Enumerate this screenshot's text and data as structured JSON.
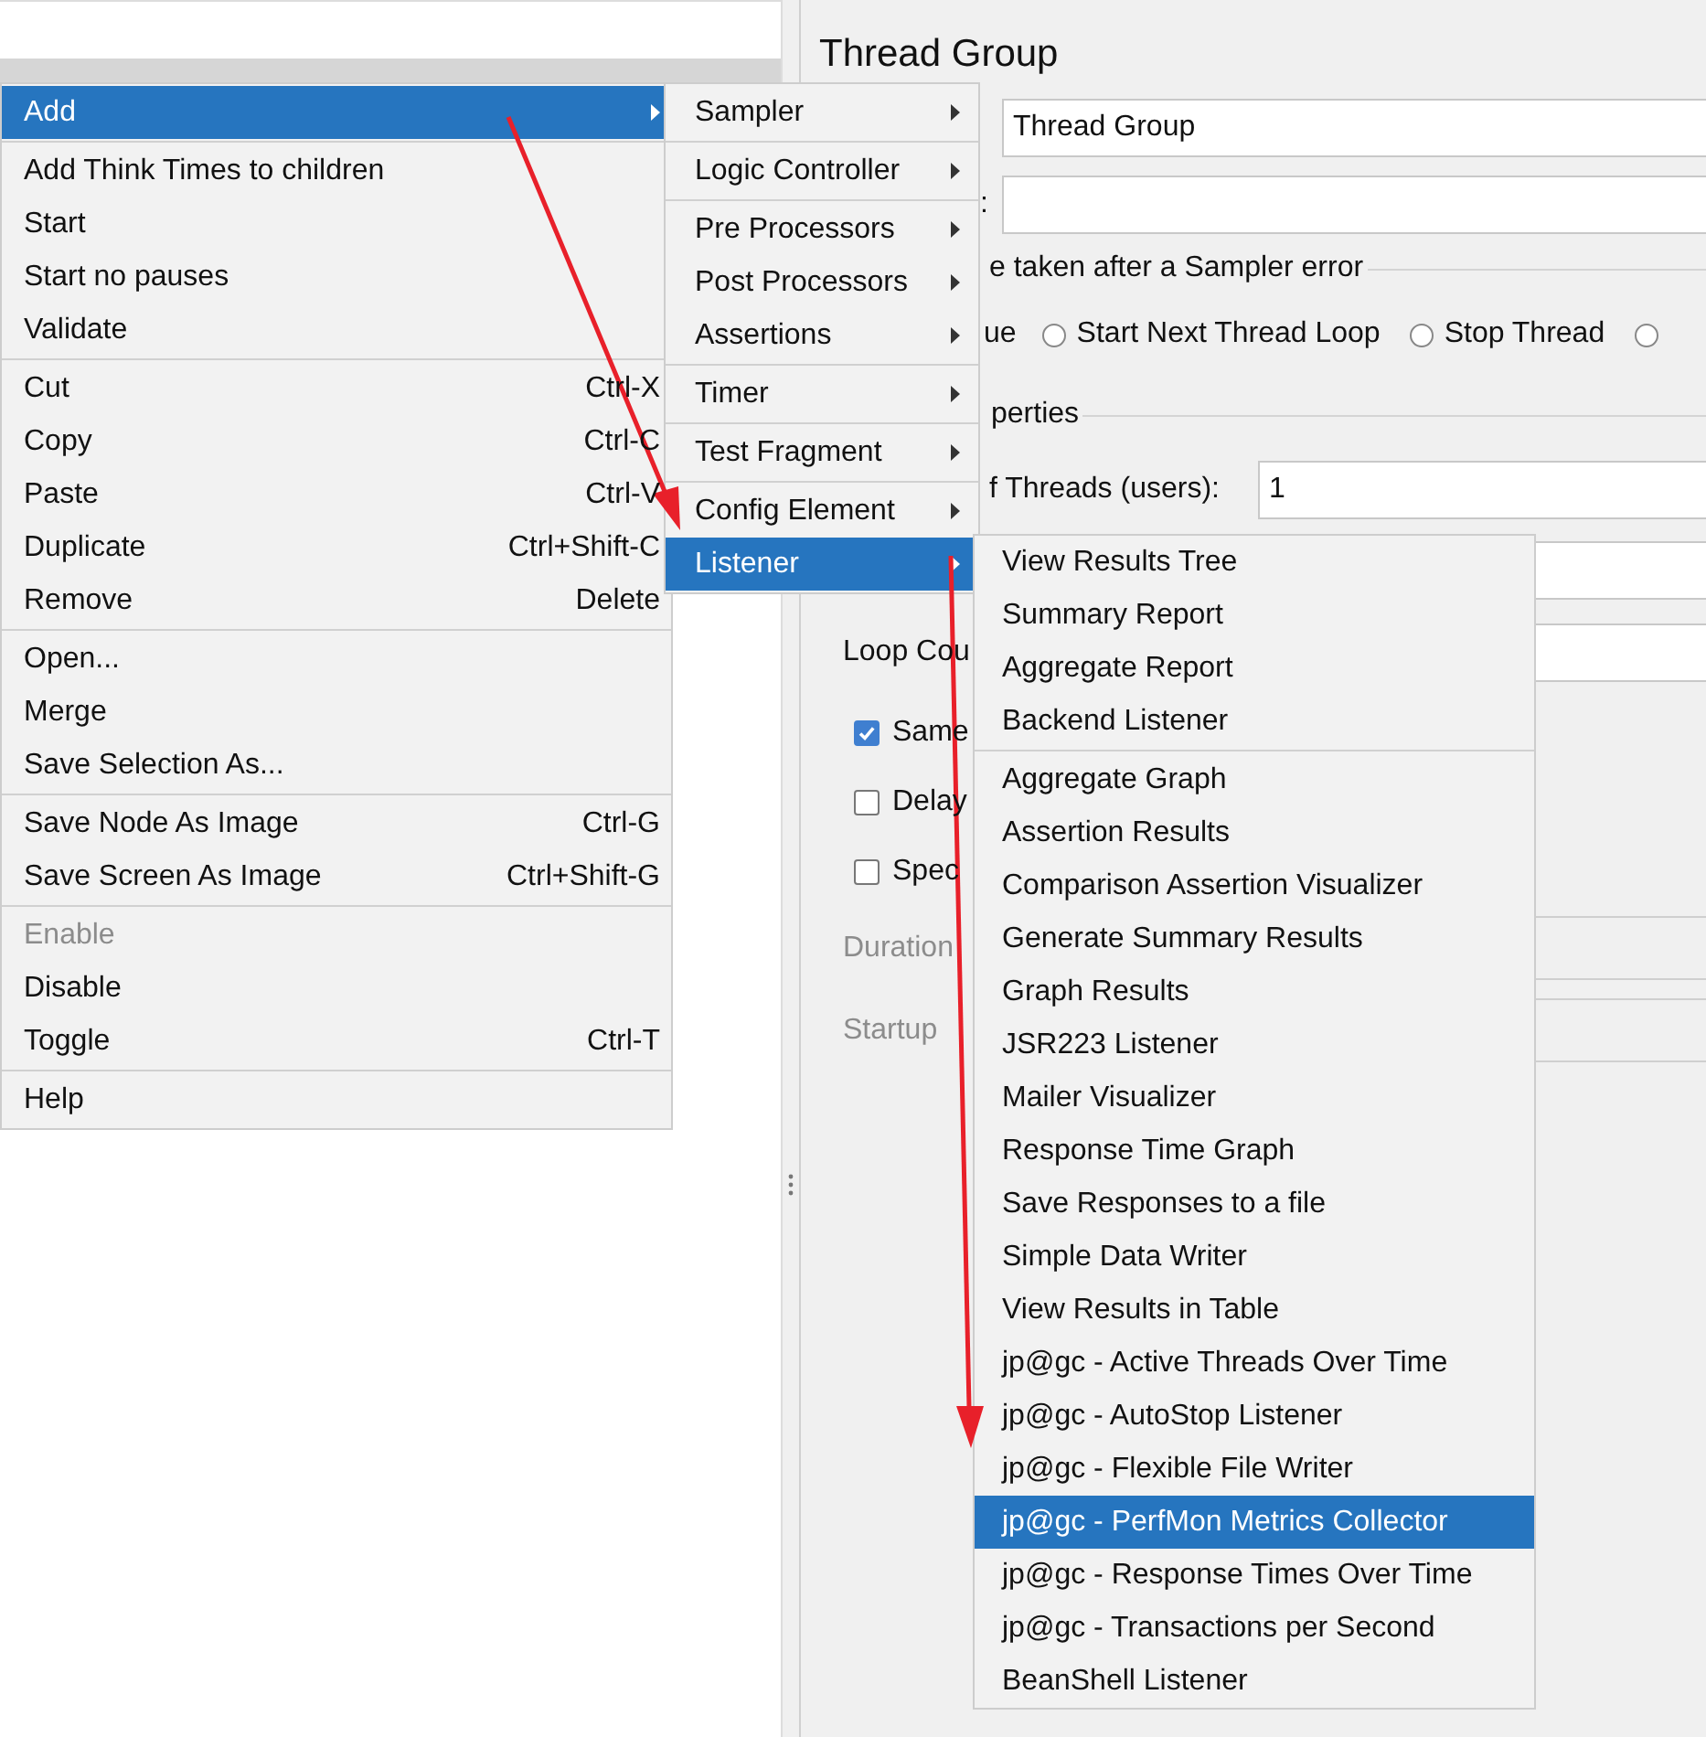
{
  "panel": {
    "title": "Thread Group",
    "name_field": {
      "value": "Thread Group"
    },
    "comments_label": ":",
    "error_group": {
      "title": "e taken after a Sampler error",
      "fragment": "ue",
      "options": [
        {
          "label": "Start Next Thread Loop",
          "selected": false
        },
        {
          "label": "Stop Thread",
          "selected": false
        },
        {
          "selected": false
        }
      ]
    },
    "properties_title": "perties",
    "threads": {
      "label": "f Threads (users):",
      "value": "1"
    },
    "loop_label": "Loop Cou",
    "checkboxes": [
      {
        "label": "Same",
        "checked": true
      },
      {
        "label": "Delay",
        "checked": false
      },
      {
        "label": "Spec",
        "checked": false
      }
    ],
    "disabled_rows": [
      {
        "label": "Duration",
        "disabled": true
      },
      {
        "label": "Startup",
        "disabled": true
      }
    ]
  },
  "context_menu": [
    {
      "kind": "submenu",
      "label": "Add",
      "selected": true
    },
    {
      "kind": "separator"
    },
    {
      "kind": "item",
      "label": "Add Think Times to children"
    },
    {
      "kind": "item",
      "label": "Start"
    },
    {
      "kind": "item",
      "label": "Start no pauses"
    },
    {
      "kind": "item",
      "label": "Validate"
    },
    {
      "kind": "separator"
    },
    {
      "kind": "item",
      "label": "Cut",
      "shortcut": "Ctrl-X"
    },
    {
      "kind": "item",
      "label": "Copy",
      "shortcut": "Ctrl-C"
    },
    {
      "kind": "item",
      "label": "Paste",
      "shortcut": "Ctrl-V"
    },
    {
      "kind": "item",
      "label": "Duplicate",
      "shortcut": "Ctrl+Shift-C"
    },
    {
      "kind": "item",
      "label": "Remove",
      "shortcut": "Delete"
    },
    {
      "kind": "separator"
    },
    {
      "kind": "item",
      "label": "Open..."
    },
    {
      "kind": "item",
      "label": "Merge"
    },
    {
      "kind": "item",
      "label": "Save Selection As..."
    },
    {
      "kind": "separator"
    },
    {
      "kind": "item",
      "label": "Save Node As Image",
      "shortcut": "Ctrl-G"
    },
    {
      "kind": "item",
      "label": "Save Screen As Image",
      "shortcut": "Ctrl+Shift-G"
    },
    {
      "kind": "separator"
    },
    {
      "kind": "item",
      "label": "Enable",
      "disabled": true
    },
    {
      "kind": "item",
      "label": "Disable",
      "disabled": false
    },
    {
      "kind": "item",
      "label": "Toggle",
      "shortcut": "Ctrl-T"
    },
    {
      "kind": "separator"
    },
    {
      "kind": "item",
      "label": "Help"
    }
  ],
  "add_submenu": [
    {
      "kind": "submenu",
      "label": "Sampler",
      "selected": false
    },
    {
      "kind": "separator"
    },
    {
      "kind": "submenu",
      "label": "Logic Controller",
      "selected": false
    },
    {
      "kind": "separator"
    },
    {
      "kind": "submenu",
      "label": "Pre Processors",
      "selected": false
    },
    {
      "kind": "submenu",
      "label": "Post Processors",
      "selected": false
    },
    {
      "kind": "submenu",
      "label": "Assertions",
      "selected": false
    },
    {
      "kind": "separator"
    },
    {
      "kind": "submenu",
      "label": "Timer",
      "selected": false
    },
    {
      "kind": "separator"
    },
    {
      "kind": "submenu",
      "label": "Test Fragment",
      "selected": false
    },
    {
      "kind": "separator"
    },
    {
      "kind": "submenu",
      "label": "Config Element",
      "selected": false
    },
    {
      "kind": "submenu",
      "label": "Listener",
      "selected": true
    }
  ],
  "listener_submenu": [
    {
      "kind": "item",
      "label": "View Results Tree",
      "selected": false
    },
    {
      "kind": "item",
      "label": "Summary Report",
      "selected": false
    },
    {
      "kind": "item",
      "label": "Aggregate Report",
      "selected": false
    },
    {
      "kind": "item",
      "label": "Backend Listener",
      "selected": false
    },
    {
      "kind": "separator"
    },
    {
      "kind": "item",
      "label": "Aggregate Graph",
      "selected": false
    },
    {
      "kind": "item",
      "label": "Assertion Results",
      "selected": false
    },
    {
      "kind": "item",
      "label": "Comparison Assertion Visualizer",
      "selected": false
    },
    {
      "kind": "item",
      "label": "Generate Summary Results",
      "selected": false
    },
    {
      "kind": "item",
      "label": "Graph Results",
      "selected": false
    },
    {
      "kind": "item",
      "label": "JSR223 Listener",
      "selected": false
    },
    {
      "kind": "item",
      "label": "Mailer Visualizer",
      "selected": false
    },
    {
      "kind": "item",
      "label": "Response Time Graph",
      "selected": false
    },
    {
      "kind": "item",
      "label": "Save Responses to a file",
      "selected": false
    },
    {
      "kind": "item",
      "label": "Simple Data Writer",
      "selected": false
    },
    {
      "kind": "item",
      "label": "View Results in Table",
      "selected": false
    },
    {
      "kind": "item",
      "label": "jp@gc - Active Threads Over Time",
      "selected": false
    },
    {
      "kind": "item",
      "label": "jp@gc - AutoStop Listener",
      "selected": false
    },
    {
      "kind": "item",
      "label": "jp@gc - Flexible File Writer",
      "selected": false
    },
    {
      "kind": "item",
      "label": "jp@gc - PerfMon Metrics Collector",
      "selected": true
    },
    {
      "kind": "item",
      "label": "jp@gc - Response Times Over Time",
      "selected": false
    },
    {
      "kind": "item",
      "label": "jp@gc - Transactions per Second",
      "selected": false
    },
    {
      "kind": "item",
      "label": "BeanShell Listener",
      "selected": false
    }
  ]
}
